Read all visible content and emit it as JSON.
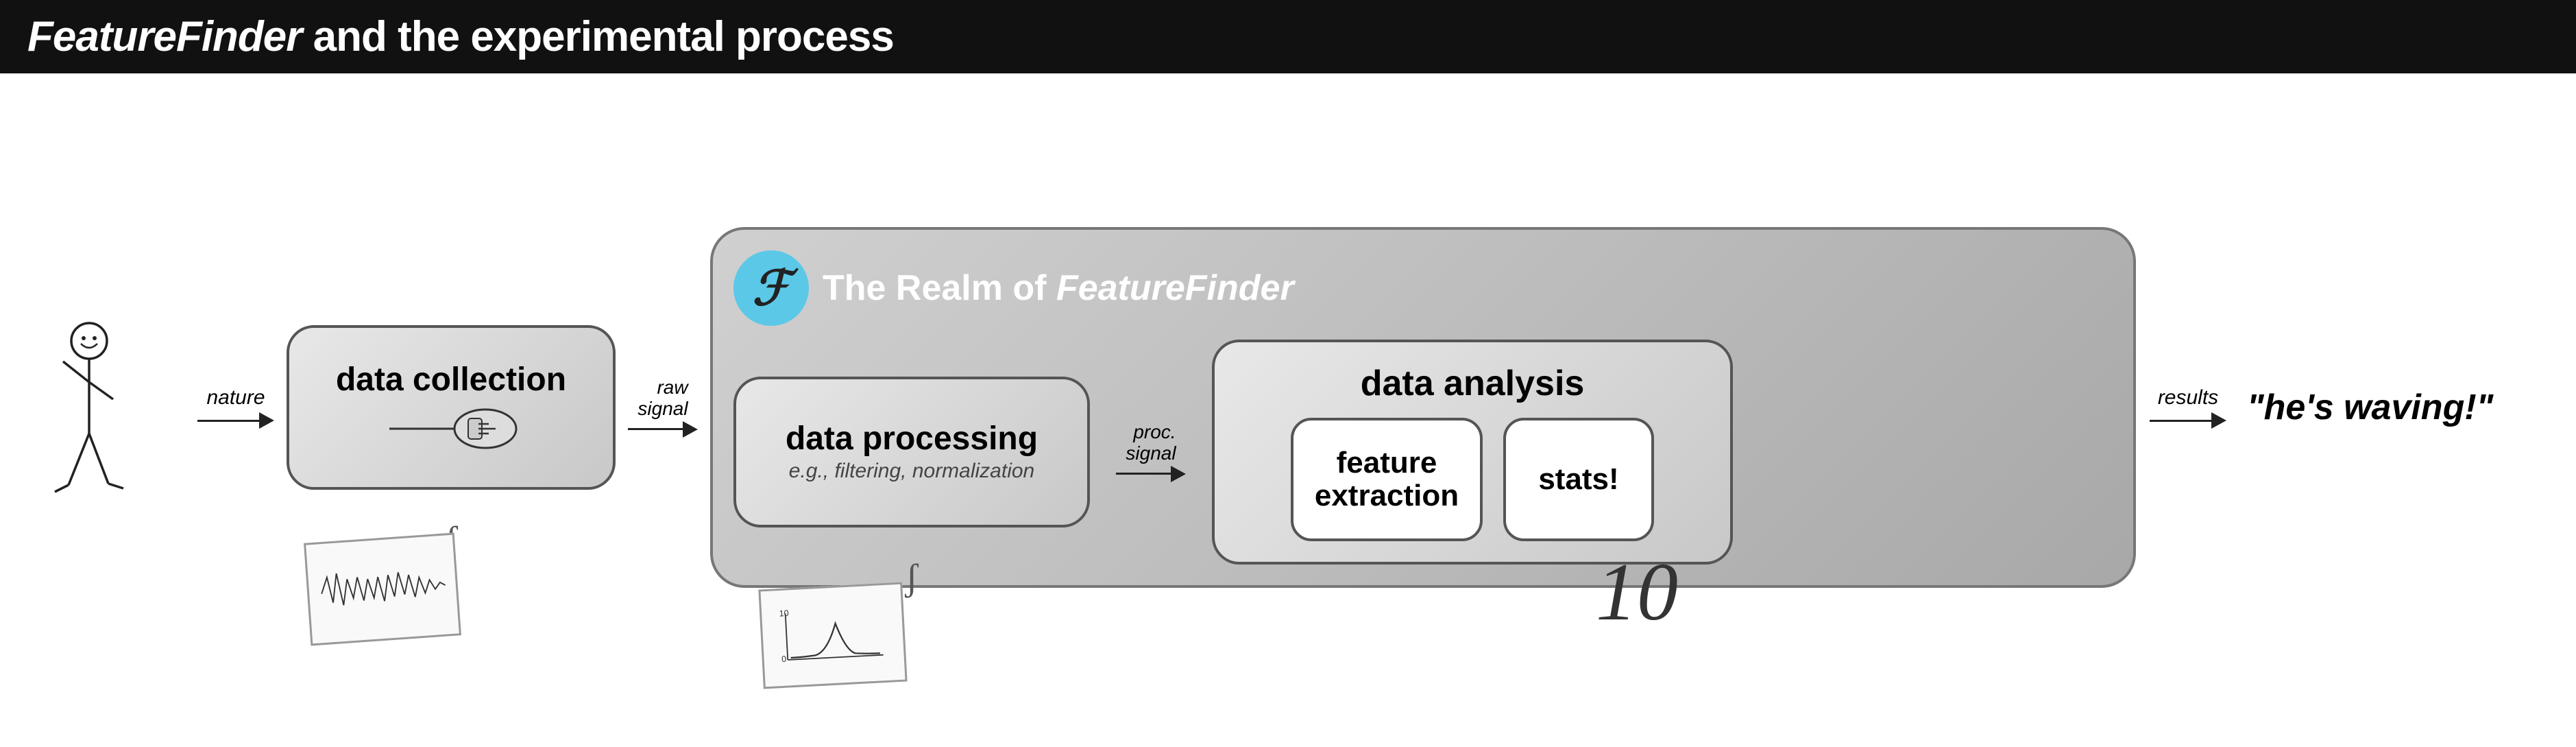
{
  "header": {
    "title_italic": "FeatureFinder",
    "title_rest": " and the experimental process"
  },
  "nature_label": "nature",
  "raw_label_line1": "raw",
  "raw_label_line2": "signal",
  "proc_label_line1": "proc.",
  "proc_label_line2": "signal",
  "results_label": "results",
  "data_collection": {
    "title": "data collection"
  },
  "realm": {
    "title_normal": "The Realm of ",
    "title_italic": "FeatureFinder"
  },
  "data_processing": {
    "title": "data processing",
    "subtitle": "e.g., filtering, normalization"
  },
  "data_analysis": {
    "title": "data analysis",
    "feature_extraction": "feature extraction",
    "stats": "stats!"
  },
  "result_quote": "\"he's waving!\""
}
